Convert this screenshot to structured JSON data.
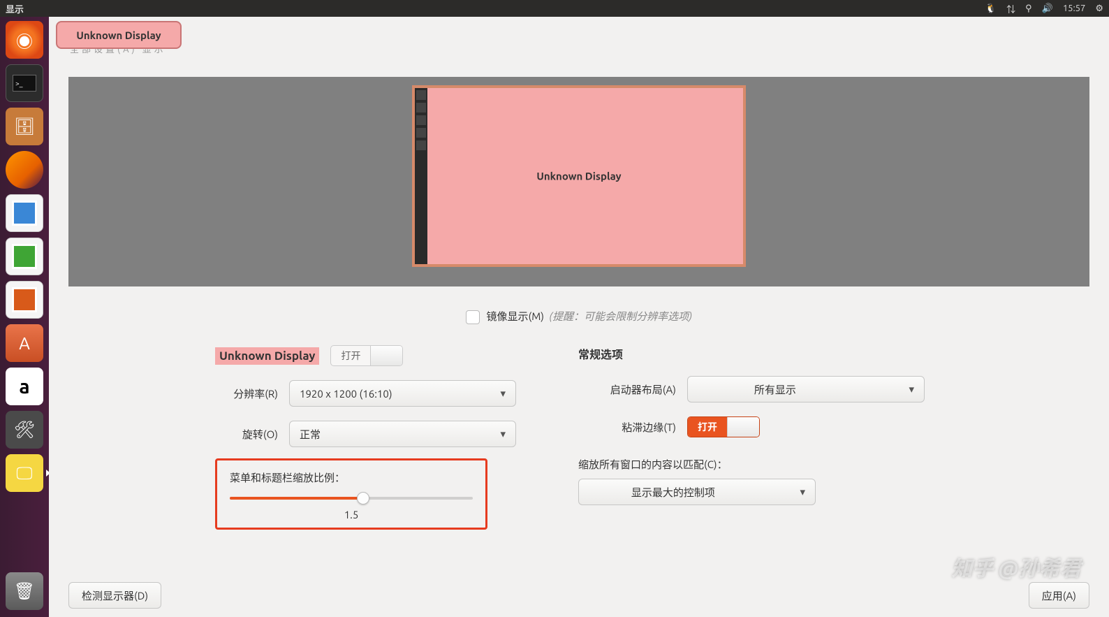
{
  "top_panel": {
    "title": "显示",
    "clock": "15:57"
  },
  "launcher": {
    "ubuntu": "ubuntu-dash",
    "terminal": ">_",
    "files": "files",
    "firefox": "firefox",
    "writer": "writer",
    "calc": "calc",
    "impress": "impress",
    "software": "A",
    "amazon": "a",
    "settings": "⚙",
    "displays": "displays",
    "trash": "🗑"
  },
  "header": {
    "display_chip": "Unknown Display",
    "ghost": "全部设置(A)    显示"
  },
  "preview": {
    "monitor_label": "Unknown Display"
  },
  "mirror": {
    "label": "镜像显示(M)",
    "hint": "(提醒：可能会限制分辨率选项)"
  },
  "left": {
    "display_name": "Unknown Display",
    "toggle_open": "打开",
    "resolution_label": "分辨率(R)",
    "resolution_value": "1920 x 1200 (16:10)",
    "rotation_label": "旋转(O)",
    "rotation_value": "正常",
    "scale_label": "菜单和标题栏缩放比例：",
    "scale_value": "1.5"
  },
  "right": {
    "section": "常规选项",
    "launcher_layout_label": "启动器布局(A)",
    "launcher_layout_value": "所有显示",
    "sticky_label": "粘滞边缘(T)",
    "sticky_toggle": "打开",
    "scale_all_label": "缩放所有窗口的内容以匹配(C)：",
    "scale_all_value": "显示最大的控制项"
  },
  "footer": {
    "detect": "检测显示器(D)",
    "apply": "应用(A)"
  },
  "watermark": "知乎 @孙希君"
}
